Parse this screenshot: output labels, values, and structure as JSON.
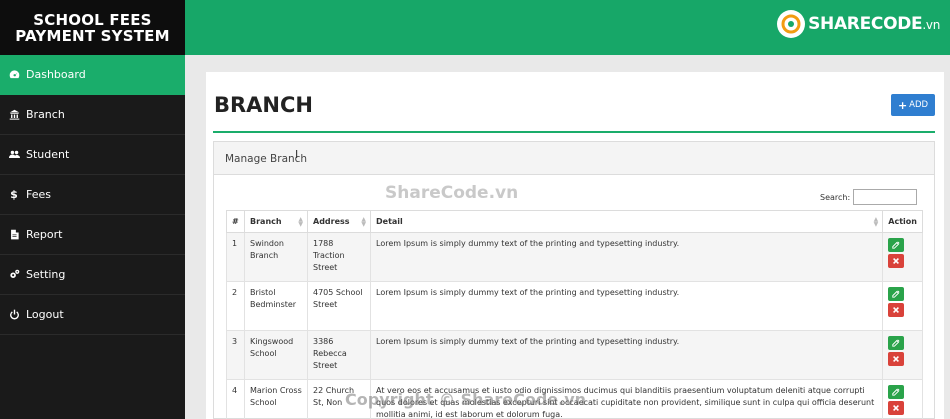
{
  "app": {
    "title_line1": "SCHOOL FEES",
    "title_line2": "PAYMENT SYSTEM"
  },
  "sidebar": {
    "items": [
      {
        "label": "Dashboard",
        "icon": "dashboard-icon",
        "active": true
      },
      {
        "label": "Branch",
        "icon": "bank-icon"
      },
      {
        "label": "Student",
        "icon": "users-icon"
      },
      {
        "label": "Fees",
        "icon": "dollar-icon"
      },
      {
        "label": "Report",
        "icon": "file-icon"
      },
      {
        "label": "Setting",
        "icon": "gears-icon"
      },
      {
        "label": "Logout",
        "icon": "power-icon"
      }
    ]
  },
  "logo": {
    "text": "SHARECODE",
    "suffix": ".vn"
  },
  "page": {
    "title": "BRANCH",
    "add_label": "ADD"
  },
  "box": {
    "heading": "Manage Branch",
    "search_label": "Search:",
    "search_value": ""
  },
  "table": {
    "headers": [
      "#",
      "Branch",
      "Address",
      "Detail",
      "Action"
    ],
    "rows": [
      {
        "num": "1",
        "branch": "Swindon Branch",
        "address": "1788 Traction Street",
        "detail": "Lorem Ipsum is simply dummy text of the printing and typesetting industry."
      },
      {
        "num": "2",
        "branch": "Bristol Bedminster",
        "address": "4705 School Street",
        "detail": "Lorem Ipsum is simply dummy text of the printing and typesetting industry."
      },
      {
        "num": "3",
        "branch": "Kingswood School",
        "address": "3386 Rebecca Street",
        "detail": "Lorem Ipsum is simply dummy text of the printing and typesetting industry."
      },
      {
        "num": "4",
        "branch": "Marion Cross School",
        "address": "22 Church St, Non",
        "detail": "At vero eos et accusamus et iusto odio dignissimos ducimus qui blanditiis praesentium voluptatum deleniti atque corrupti quos dolores et quas molestias excepturi sint occaecati cupiditate non provident, similique sunt in culpa qui officia deserunt mollitia animi, id est laborum et dolorum fuga."
      }
    ]
  },
  "watermark": {
    "center": "ShareCode.vn",
    "bottom": "Copyright © ShareCode.vn"
  },
  "colors": {
    "accent": "#1aad6b",
    "primary": "#2f7ed0",
    "danger": "#d9423a",
    "success": "#2aa34a"
  }
}
